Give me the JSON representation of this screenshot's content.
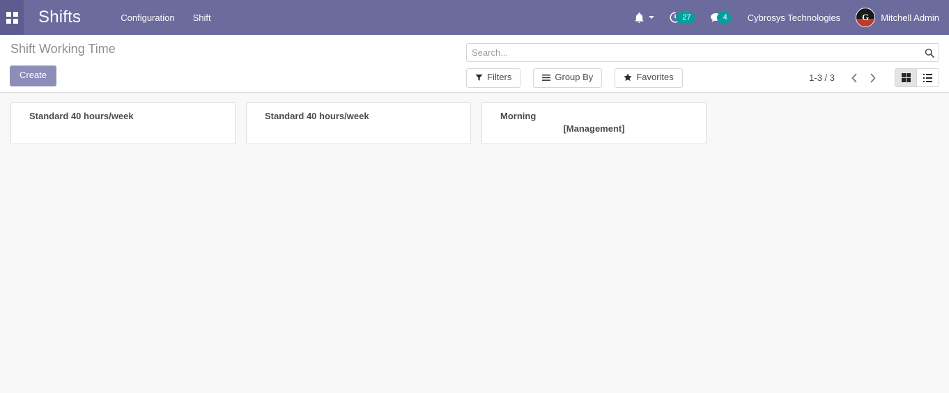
{
  "navbar": {
    "apps_icon": "apps-grid-icon",
    "brand": "Shifts",
    "menus": [
      {
        "label": "Configuration"
      },
      {
        "label": "Shift"
      }
    ],
    "bell_icon": "bell-icon",
    "activity": {
      "icon": "clock-activity-icon",
      "count": "27"
    },
    "messaging": {
      "icon": "chat-bubble-icon",
      "count": "4"
    },
    "company": "Cybrosys Technologies",
    "user": {
      "name": "Mitchell Admin",
      "avatar_letter": "G"
    },
    "colors": {
      "navbar_bg": "#6b6b9e",
      "apps_bg": "#5c5c91",
      "counter_bg": "#00a09d"
    }
  },
  "control_panel": {
    "breadcrumb": "Shift Working Time",
    "create_label": "Create",
    "search": {
      "placeholder": "Search...",
      "value": "",
      "icon": "search-icon"
    },
    "buttons": [
      {
        "label": "Filters",
        "icon": "filter-funnel-icon",
        "glyph": "▼"
      },
      {
        "label": "Group By",
        "icon": "hamburger-lines-icon",
        "glyph": "☰"
      },
      {
        "label": "Favorites",
        "icon": "star-icon",
        "glyph": "★"
      }
    ],
    "pager": {
      "value": "1-3 / 3",
      "prev_icon": "chevron-left-icon",
      "next_icon": "chevron-right-icon"
    },
    "view_switcher": [
      {
        "name": "kanban",
        "icon": "kanban-grid-icon",
        "active": true
      },
      {
        "name": "list",
        "icon": "list-view-icon",
        "active": false
      }
    ]
  },
  "kanban": {
    "records": [
      {
        "title": "Standard 40 hours/week",
        "subtitle": ""
      },
      {
        "title": "Standard 40 hours/week",
        "subtitle": ""
      },
      {
        "title": "Morning",
        "subtitle": "[Management]"
      }
    ]
  }
}
